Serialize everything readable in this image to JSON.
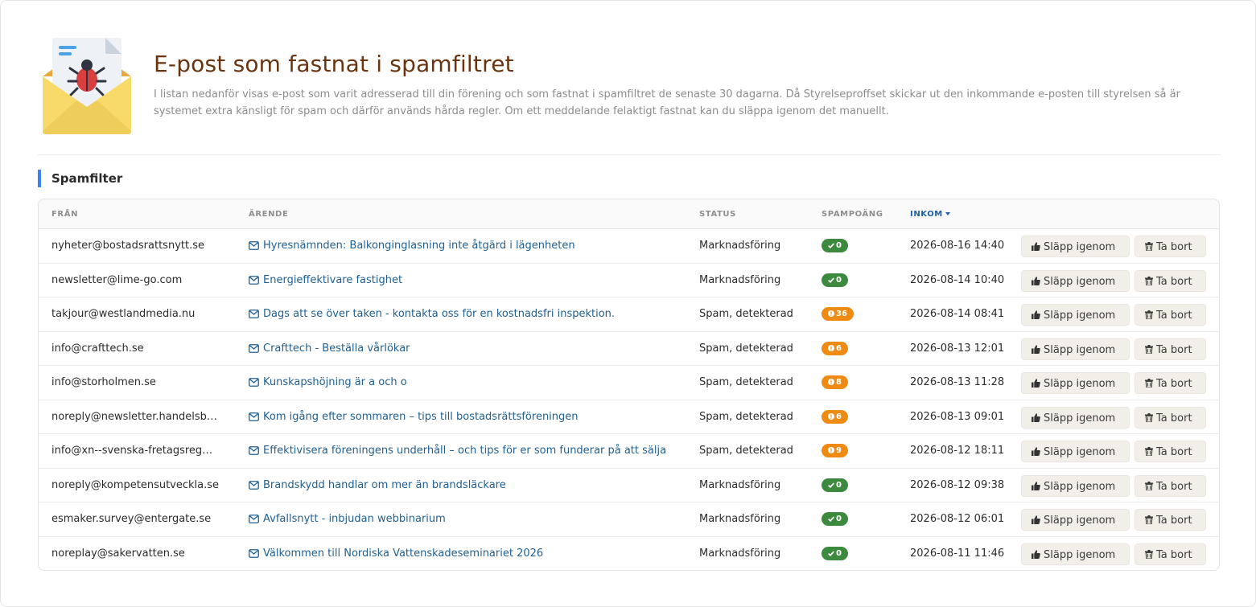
{
  "header": {
    "title": "E-post som fastnat i spamfiltret",
    "description": "I listan nedanför visas e-post som varit adresserad till din förening och som fastnat i spamfiltret de senaste 30 dagarna. Då Styrelseproffset skickar ut den inkommande e-posten till styrelsen så är systemet extra känsligt för spam och därför används hårda regler. Om ett meddelande felaktigt fastnat kan du släppa igenom det manuellt."
  },
  "section": {
    "title": "Spamfilter"
  },
  "table": {
    "columns": {
      "from": "FRÅN",
      "subject": "ÄRENDE",
      "status": "STATUS",
      "score": "SPAMPOÄNG",
      "received": "INKOM"
    },
    "release_label": "Släpp igenom",
    "delete_label": "Ta bort",
    "rows": [
      {
        "from": "nyheter@bostadsrattsnytt.se",
        "subject": "Hyresnämnden: Balkonginglasning inte åtgärd i lägenheten",
        "status": "Marknadsföring",
        "score": "0",
        "level": "ok",
        "received": "2026-08-16 14:40"
      },
      {
        "from": "newsletter@lime-go.com",
        "subject": "Energieffektivare fastighet",
        "status": "Marknadsföring",
        "score": "0",
        "level": "ok",
        "received": "2026-08-14 10:40"
      },
      {
        "from": "takjour@westlandmedia.nu",
        "subject": "Dags att se över taken - kontakta oss för en kostnadsfri inspektion.",
        "status": "Spam, detekterad",
        "score": "36",
        "level": "warn",
        "received": "2026-08-14 08:41"
      },
      {
        "from": "info@crafttech.se",
        "subject": "Crafttech - Beställa vårlökar",
        "status": "Spam, detekterad",
        "score": "6",
        "level": "warn",
        "received": "2026-08-13 12:01"
      },
      {
        "from": "info@storholmen.se",
        "subject": "Kunskapshöjning är a och o",
        "status": "Spam, detekterad",
        "score": "8",
        "level": "warn",
        "received": "2026-08-13 11:28"
      },
      {
        "from": "noreply@newsletter.handelsb…",
        "subject": "Kom igång efter sommaren – tips till bostadsrättsföreningen",
        "status": "Spam, detekterad",
        "score": "6",
        "level": "warn",
        "received": "2026-08-13 09:01"
      },
      {
        "from": "info@xn--svenska-fretagsreg…",
        "subject": "Effektivisera föreningens underhåll – och tips för er som funderar på att sälja",
        "status": "Spam, detekterad",
        "score": "9",
        "level": "warn",
        "received": "2026-08-12 18:11"
      },
      {
        "from": "noreply@kompetensutveckla.se",
        "subject": "Brandskydd handlar om mer än brandsläckare",
        "status": "Marknadsföring",
        "score": "0",
        "level": "ok",
        "received": "2026-08-12 09:38"
      },
      {
        "from": "esmaker.survey@entergate.se",
        "subject": "Avfallsnytt - inbjudan webbinarium",
        "status": "Marknadsföring",
        "score": "0",
        "level": "ok",
        "received": "2026-08-12 06:01"
      },
      {
        "from": "noreplay@sakervatten.se",
        "subject": "Välkommen till Nordiska Vattenskadeseminariet 2026",
        "status": "Marknadsföring",
        "score": "0",
        "level": "ok",
        "received": "2026-08-11 11:46"
      }
    ]
  },
  "icons": {
    "hero": "spam-envelope-bug-icon",
    "subject": "envelope-icon",
    "ok": "check-icon",
    "warn": "exclamation-circle-icon",
    "release": "thumbs-up-icon",
    "delete": "trash-icon",
    "sort": "caret-down-icon"
  },
  "colors": {
    "title": "#6a3410",
    "link": "#1f5f92",
    "accent": "#3b82f6",
    "ok": "#3c8a3e",
    "warn": "#ef8b12",
    "sorted": "#1f5fa8"
  }
}
